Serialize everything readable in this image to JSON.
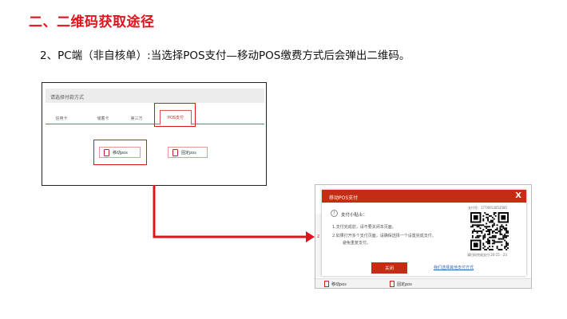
{
  "heading": "二、二维码获取途径",
  "subheading": "2、PC端（非自核单）:当选择POS支付—移动POS缴费方式后会弹出二维码。",
  "colors": {
    "accent": "#e0141e",
    "dialog_header": "#c62b14",
    "link": "#2f62b3"
  },
  "payment_select": {
    "title": "请选择付款方式",
    "tabs": [
      {
        "label": "信用卡"
      },
      {
        "label": "储蓄卡"
      },
      {
        "label": "第三方"
      },
      {
        "label": "POS支付",
        "active": true
      }
    ],
    "buttons": {
      "mobile": {
        "label": "移动pos",
        "icon": "pos-terminal-icon",
        "highlighted": true
      },
      "fixed": {
        "label": "固定pos",
        "icon": "pos-terminal-icon"
      }
    }
  },
  "dialog": {
    "title": "移动POS支付",
    "close_glyph": "X",
    "tip_icon_glyph": "!",
    "tip_title": "支付小贴士：",
    "tips": [
      "1.支付完成前，请不要关闭本页面。",
      "2.如果打开多个支付页面，请确保选择一个设置完成支付，",
      "避免重复支付。"
    ],
    "pay_no": "支付号：1774913053585",
    "qr_caption": "请扫码完成支付 20:15 - 23",
    "close_button": "关闭",
    "other_link": "我们选择其他支付方式"
  },
  "bottom_bar": {
    "buttons": [
      {
        "label": "移动pos",
        "icon": "pos-terminal-icon"
      },
      {
        "label": "固定pos",
        "icon": "pos-terminal-icon"
      }
    ]
  }
}
